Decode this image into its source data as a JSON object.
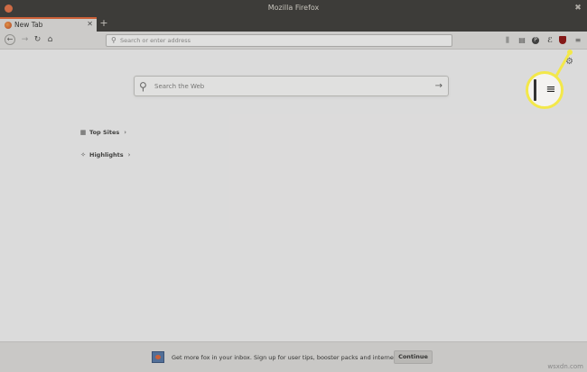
{
  "window": {
    "title": "Mozilla Firefox",
    "close_glyph": "●",
    "maximize_glyph": "✖"
  },
  "tabs": [
    {
      "label": "New Tab",
      "close_glyph": "✕"
    }
  ],
  "new_tab_glyph": "+",
  "nav": {
    "back_glyph": "←",
    "forward_glyph": "→",
    "reload_glyph": "↻",
    "home_glyph": "⌂",
    "url_search_glyph": "⚲",
    "url_placeholder": "Search or enter address"
  },
  "toolbar_icons": {
    "library": "⫼",
    "sidebar": "▤",
    "pocket": "P",
    "extension": "ℰ",
    "menu": "≡"
  },
  "newtab": {
    "settings_glyph": "⚙",
    "search_glyph": "⚲",
    "search_placeholder": "Search the Web",
    "search_go_glyph": "→",
    "sections": [
      {
        "label": "Top Sites",
        "icon_glyph": "▦",
        "chevron": "›"
      },
      {
        "label": "Highlights",
        "icon_glyph": "✧",
        "chevron": "›"
      }
    ]
  },
  "callout": {
    "menu_glyph": "≡",
    "color": "#f3e84a"
  },
  "snippet": {
    "text": "Get more fox in your inbox. Sign up for user tips, booster packs and internet intel.",
    "button_label": "Continue"
  },
  "watermark": "wsxdn.com",
  "colors": {
    "accent": "#e55b2a",
    "titlebar": "#2f2d2b",
    "highlight": "#f3e84a"
  }
}
